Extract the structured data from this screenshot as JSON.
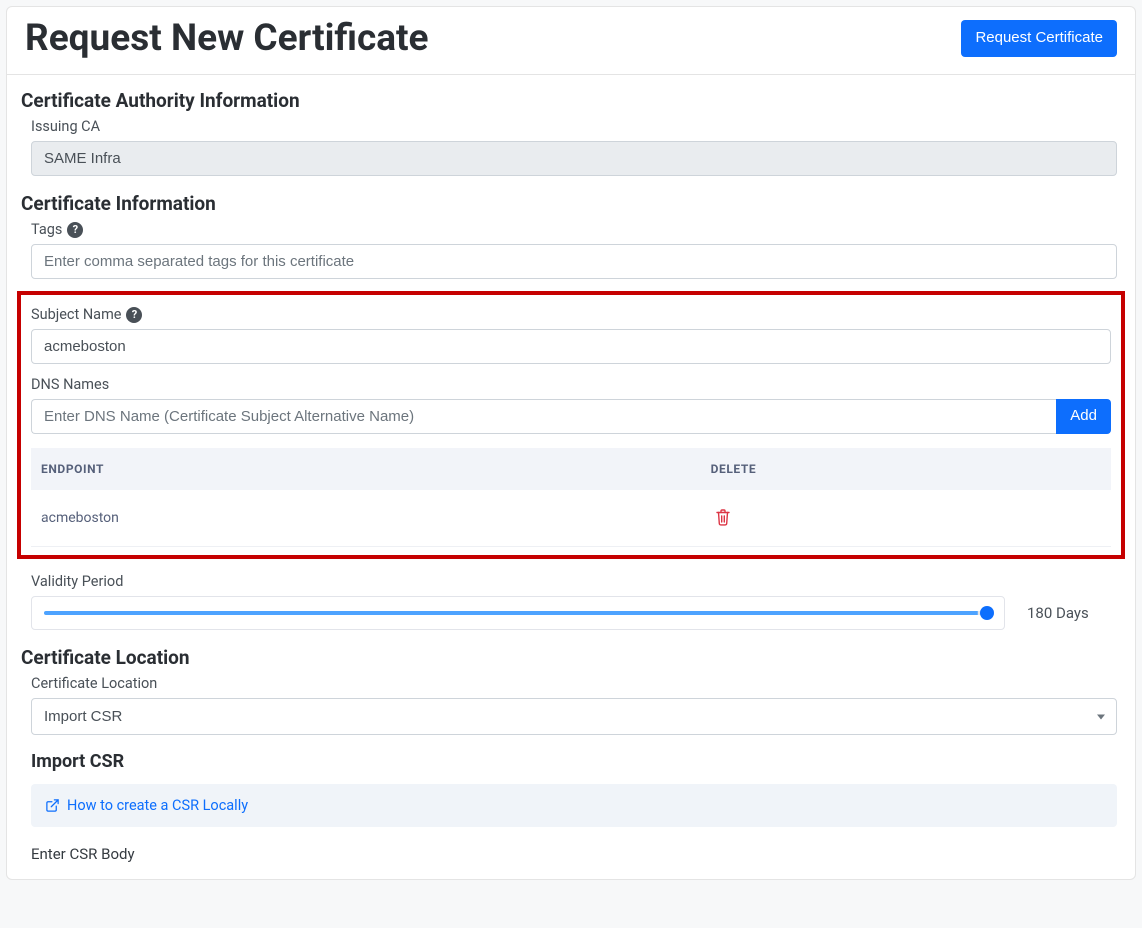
{
  "header": {
    "title": "Request New Certificate",
    "request_button": "Request Certificate"
  },
  "ca_info": {
    "section_title": "Certificate Authority Information",
    "issuing_label": "Issuing CA",
    "issuing_value": "SAME Infra"
  },
  "cert_info": {
    "section_title": "Certificate Information",
    "tags_label": "Tags",
    "tags_placeholder": "Enter comma separated tags for this certificate",
    "subject_label": "Subject Name",
    "subject_value": "acmeboston",
    "dns_label": "DNS Names",
    "dns_placeholder": "Enter DNS Name (Certificate Subject Alternative Name)",
    "add_button": "Add",
    "table_header_endpoint": "ENDPOINT",
    "table_header_delete": "DELETE",
    "dns_rows": [
      {
        "endpoint": "acmeboston"
      }
    ],
    "validity_label": "Validity Period",
    "validity_value": "180 Days"
  },
  "cert_location": {
    "section_title": "Certificate Location",
    "location_label": "Certificate Location",
    "location_value": "Import CSR",
    "import_title": "Import CSR",
    "help_link": "How to create a CSR Locally",
    "csr_body_label": "Enter CSR Body"
  }
}
